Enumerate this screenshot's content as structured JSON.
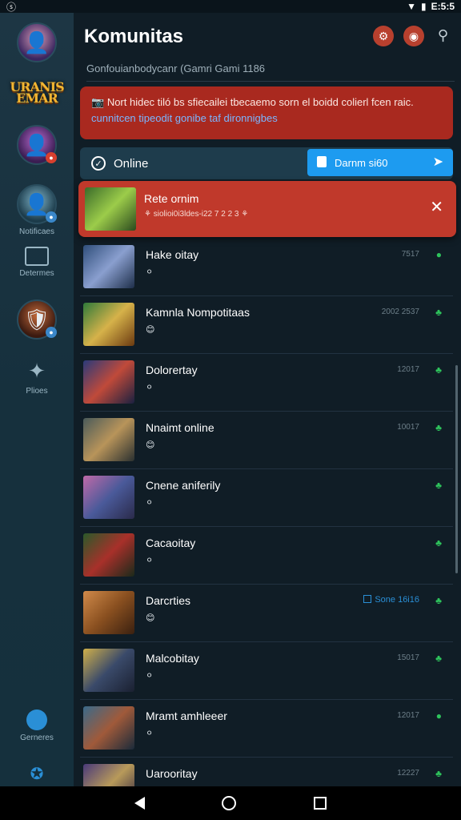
{
  "status_bar": {
    "left_icon": "ⓢ",
    "time": "E:5:5",
    "icons": [
      "wifi-icon",
      "battery-icon"
    ]
  },
  "sidebar": {
    "logo": "URANIS\nEMAR",
    "items": [
      {
        "label": ""
      },
      {
        "label": ""
      },
      {
        "label": "Notificaes"
      },
      {
        "label": "Determes"
      },
      {
        "label": ""
      },
      {
        "label": "Plioes"
      },
      {
        "label": "Gerneres"
      }
    ]
  },
  "header": {
    "title": "Komunitas",
    "subtitle": "Gonfouianbodycanr (Gamri Gami  1186"
  },
  "alert": {
    "icon": "📷",
    "text": "Nort hidec tiló bs sfiecailei tbecaemo sorn el boidd colierl fcen raic.",
    "link": "cunnitcen tipeodit gonibe taf dironnigbes"
  },
  "online_bar": {
    "label": "Online",
    "button_label": "Darnm si60"
  },
  "highlight": {
    "name": "Rete ornim",
    "sub": "⚘ siolioi0i3ldes-i22 7 2 2 3 ⚘"
  },
  "rows": [
    {
      "name": "Hake oitay",
      "time": "7517",
      "status": "●",
      "emoji": "⚪"
    },
    {
      "name": "Kamnla Nompotitaas",
      "time": "2002 2537",
      "status": "♣",
      "emoji": "😊"
    },
    {
      "name": "Dolorertay",
      "time": "12017",
      "status": "♣",
      "emoji": "⚪"
    },
    {
      "name": "Nnaimt online",
      "time": "10017",
      "status": "♣",
      "emoji": "😊"
    },
    {
      "name": "Cnene aniferily",
      "time": "",
      "status": "♣",
      "emoji": "⚪"
    },
    {
      "name": "Cacaoitay",
      "time": "",
      "status": "♣",
      "emoji": "⚪"
    },
    {
      "name": "Darcrties",
      "time": "",
      "status": "♣",
      "emoji": "😊",
      "tag": "Sone 16i16"
    },
    {
      "name": "Malcobitay",
      "time": "15017",
      "status": "♣",
      "emoji": "⚪"
    },
    {
      "name": "Mramt amhleeer",
      "time": "12017",
      "status": "●",
      "emoji": "⚪"
    },
    {
      "name": "Uarooritay",
      "time": "12227",
      "status": "♣",
      "emoji": ""
    }
  ],
  "colors": {
    "bg": "#101d26",
    "sidebar": "#1d3644",
    "alert": "#a9291f",
    "highlight": "#c0392b",
    "accent": "#1d9bf0",
    "online": "#2ec45c"
  }
}
